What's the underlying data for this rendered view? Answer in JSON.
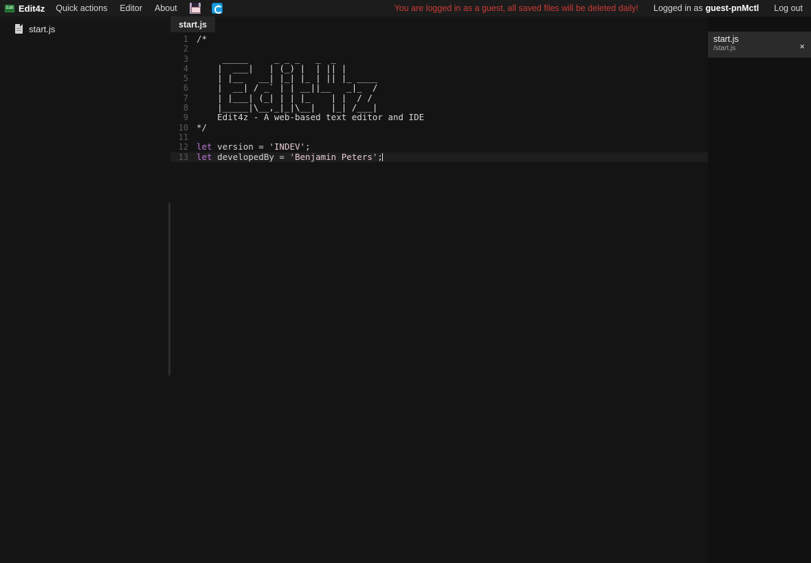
{
  "topbar": {
    "logo_text": "Edit",
    "brand": "Edit4z",
    "menu": [
      {
        "label": "Quick actions",
        "name": "menu-quick-actions"
      },
      {
        "label": "Editor",
        "name": "menu-editor"
      },
      {
        "label": "About",
        "name": "menu-about"
      }
    ],
    "icons": [
      {
        "name": "save-icon",
        "title": "Save"
      },
      {
        "name": "refresh-icon",
        "title": "Refresh"
      }
    ],
    "guest_warning": "You are logged in as a guest, all saved files will be deleted daily!",
    "logged_in_prefix": "Logged in as",
    "username": "guest-pnMctl",
    "logout": "Log out",
    "warning_color": "#cc3b38"
  },
  "sidebar": {
    "files": [
      {
        "label": "start.js"
      }
    ]
  },
  "editor": {
    "tabs": [
      {
        "label": "start.js",
        "active": true
      }
    ],
    "filename": "start.js",
    "lines": [
      {
        "n": "1",
        "segments": [
          {
            "t": "/*",
            "c": "tok-comment"
          }
        ]
      },
      {
        "n": "2",
        "segments": [
          {
            "t": "",
            "c": "tok-comment"
          }
        ]
      },
      {
        "n": "3",
        "segments": [
          {
            "t": "     _____     _ _ _   _  _",
            "c": "tok-art"
          }
        ]
      },
      {
        "n": "4",
        "segments": [
          {
            "t": "    |  ___|   | (_) |  | || |",
            "c": "tok-art"
          }
        ]
      },
      {
        "n": "5",
        "segments": [
          {
            "t": "    | |__   __| |_| |_ | || |_ ____",
            "c": "tok-art"
          }
        ]
      },
      {
        "n": "6",
        "segments": [
          {
            "t": "    |  __| / _` | | __||__   _|_  /",
            "c": "tok-art"
          }
        ]
      },
      {
        "n": "7",
        "segments": [
          {
            "t": "    | |___| (_| | | |_    | |  / /",
            "c": "tok-art"
          }
        ]
      },
      {
        "n": "8",
        "segments": [
          {
            "t": "    |_____|\\__,_|_|\\__|   |_| /___|",
            "c": "tok-art"
          }
        ]
      },
      {
        "n": "9",
        "segments": [
          {
            "t": "    Edit4z - A web-based text editor and IDE",
            "c": "tok-comment"
          }
        ]
      },
      {
        "n": "10",
        "segments": [
          {
            "t": "*/",
            "c": "tok-comment"
          }
        ]
      },
      {
        "n": "11",
        "segments": [
          {
            "t": "",
            "c": "tok-plain"
          }
        ]
      },
      {
        "n": "12",
        "segments": [
          {
            "t": "let",
            "c": "tok-kw"
          },
          {
            "t": " version = ",
            "c": "tok-plain"
          },
          {
            "t": "'INDEV'",
            "c": "tok-str"
          },
          {
            "t": ";",
            "c": "tok-plain"
          }
        ]
      },
      {
        "n": "13",
        "active": true,
        "caret": true,
        "segments": [
          {
            "t": "let",
            "c": "tok-kw"
          },
          {
            "t": " developedBy = ",
            "c": "tok-plain"
          },
          {
            "t": "'Benjamin Peters'",
            "c": "tok-str"
          },
          {
            "t": ";",
            "c": "tok-plain"
          }
        ]
      }
    ]
  },
  "toast": {
    "title": "start.js",
    "subtitle": "/start.js",
    "close_label": "×"
  }
}
